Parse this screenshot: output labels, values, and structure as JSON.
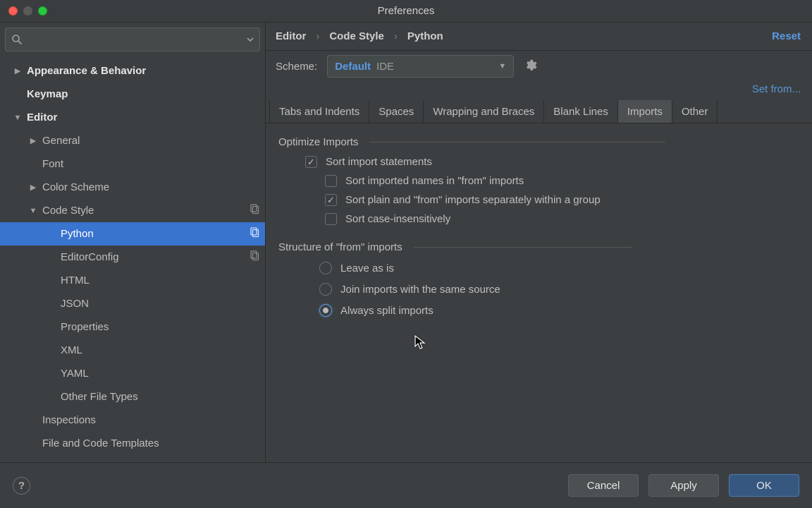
{
  "window": {
    "title": "Preferences"
  },
  "search": {
    "placeholder": ""
  },
  "sidebar": {
    "items": [
      {
        "label": "Appearance & Behavior",
        "depth": 0,
        "bold": true,
        "expandable": true,
        "expanded": false
      },
      {
        "label": "Keymap",
        "depth": 0,
        "bold": true,
        "expandable": false
      },
      {
        "label": "Editor",
        "depth": 0,
        "bold": true,
        "expandable": true,
        "expanded": true
      },
      {
        "label": "General",
        "depth": 1,
        "expandable": true,
        "expanded": false
      },
      {
        "label": "Font",
        "depth": 1
      },
      {
        "label": "Color Scheme",
        "depth": 1,
        "expandable": true,
        "expanded": false
      },
      {
        "label": "Code Style",
        "depth": 1,
        "expandable": true,
        "expanded": true,
        "copy": true
      },
      {
        "label": "Python",
        "depth": 2,
        "copy": true,
        "selected": true
      },
      {
        "label": "EditorConfig",
        "depth": 2,
        "copy": true
      },
      {
        "label": "HTML",
        "depth": 2
      },
      {
        "label": "JSON",
        "depth": 2
      },
      {
        "label": "Properties",
        "depth": 2
      },
      {
        "label": "XML",
        "depth": 2
      },
      {
        "label": "YAML",
        "depth": 2
      },
      {
        "label": "Other File Types",
        "depth": 2
      },
      {
        "label": "Inspections",
        "depth": 1
      },
      {
        "label": "File and Code Templates",
        "depth": 1
      }
    ]
  },
  "breadcrumb": {
    "crumbs": [
      "Editor",
      "Code Style",
      "Python"
    ],
    "sep": "›",
    "reset": "Reset"
  },
  "scheme": {
    "label": "Scheme:",
    "name": "Default",
    "scope": "IDE"
  },
  "set_from": "Set from...",
  "tabs": {
    "items": [
      "Tabs and Indents",
      "Spaces",
      "Wrapping and Braces",
      "Blank Lines",
      "Imports",
      "Other"
    ],
    "active": "Imports"
  },
  "optimize": {
    "heading": "Optimize Imports",
    "options": [
      {
        "label": "Sort import statements",
        "checked": true,
        "indent": 1
      },
      {
        "label": "Sort imported names in \"from\" imports",
        "checked": false,
        "indent": 2
      },
      {
        "label": "Sort plain and \"from\" imports separately within a group",
        "checked": true,
        "indent": 2
      },
      {
        "label": "Sort case-insensitively",
        "checked": false,
        "indent": 2
      }
    ]
  },
  "structure": {
    "heading": "Structure of \"from\" imports",
    "options": [
      {
        "label": "Leave as is",
        "selected": false
      },
      {
        "label": "Join imports with the same source",
        "selected": false
      },
      {
        "label": "Always split imports",
        "selected": true
      }
    ]
  },
  "footer": {
    "help": "?",
    "cancel": "Cancel",
    "apply": "Apply",
    "ok": "OK"
  }
}
